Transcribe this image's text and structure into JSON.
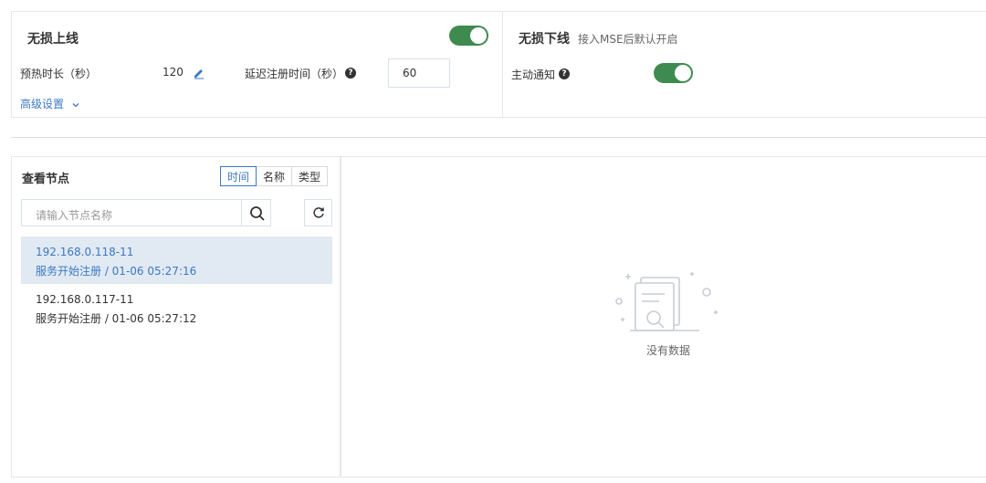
{
  "graceful_online": {
    "title": "无损上线",
    "enabled": true,
    "warmup_label": "预热时长（秒）",
    "warmup_value": "120",
    "delay_label": "延迟注册时间（秒）",
    "delay_value": "60",
    "advanced_label": "高级设置"
  },
  "graceful_offline": {
    "title": "无损下线",
    "subtitle": "接入MSE后默认开启",
    "notify_label": "主动通知",
    "notify_enabled": true
  },
  "nodes": {
    "title": "查看节点",
    "tabs": [
      "时间",
      "名称",
      "类型"
    ],
    "active_tab": "时间",
    "search_placeholder": "请输入节点名称",
    "items": [
      {
        "name": "192.168.0.118-11",
        "detail": "服务开始注册 / 01-06 05:27:16",
        "selected": true
      },
      {
        "name": "192.168.0.117-11",
        "detail": "服务开始注册 / 01-06 05:27:12",
        "selected": false
      }
    ]
  },
  "empty_state": {
    "text": "没有数据"
  },
  "colors": {
    "accent": "#3c79c1",
    "toggle_on": "#3f8b4f",
    "selected_bg": "#e1e9f3"
  }
}
